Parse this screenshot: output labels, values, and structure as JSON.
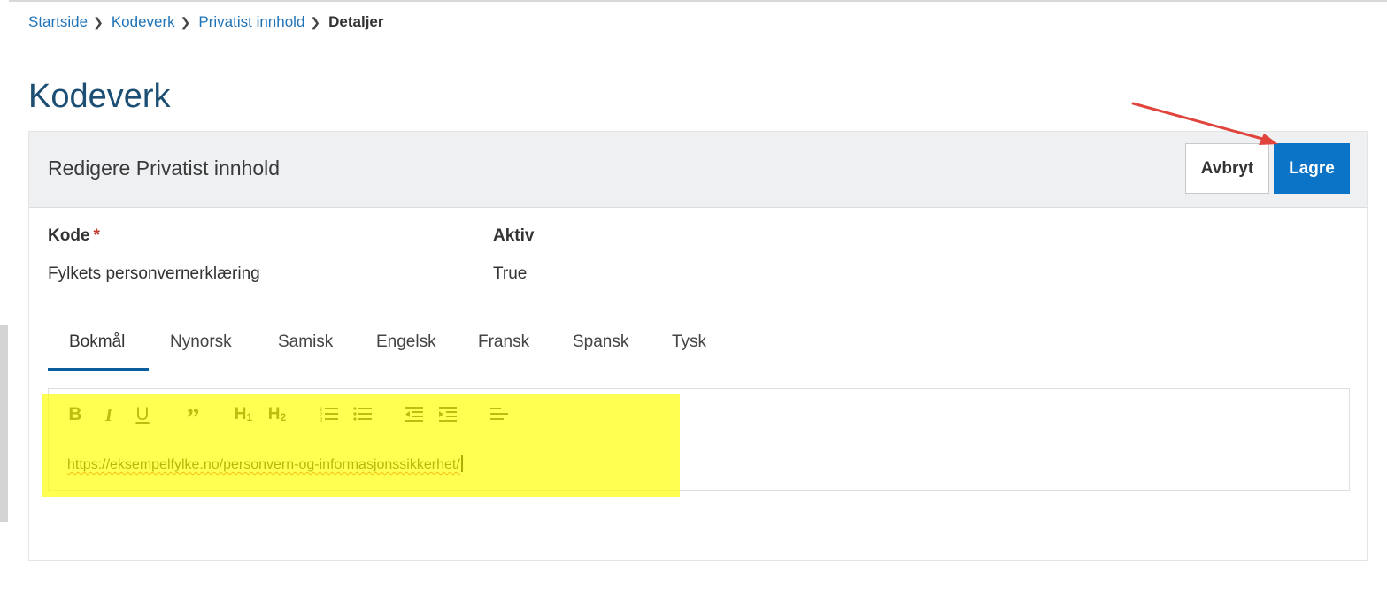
{
  "breadcrumb": {
    "items": [
      "Startside",
      "Kodeverk",
      "Privatist innhold"
    ],
    "current": "Detaljer"
  },
  "page": {
    "title": "Kodeverk"
  },
  "card": {
    "title": "Redigere Privatist innhold",
    "cancel_label": "Avbryt",
    "save_label": "Lagre"
  },
  "fields": {
    "kode_label": "Kode",
    "required_marker": "*",
    "kode_value": "Fylkets personvernerklæring",
    "aktiv_label": "Aktiv",
    "aktiv_value": "True"
  },
  "tabs": [
    "Bokmål",
    "Nynorsk",
    "Samisk",
    "Engelsk",
    "Fransk",
    "Spansk",
    "Tysk"
  ],
  "active_tab": "Bokmål",
  "editor": {
    "toolbar": [
      "bold-icon",
      "italic-icon",
      "underline-icon",
      "quote-icon",
      "heading1-icon",
      "heading2-icon",
      "ordered-list-icon",
      "bullet-list-icon",
      "outdent-icon",
      "indent-icon",
      "align-left-icon"
    ],
    "content": "https://eksempelfylke.no/personvern-og-informasjonssikkerhet/"
  },
  "colors": {
    "link": "#1f73b7",
    "title": "#1d4f74",
    "primary_button": "#0b74c6",
    "highlight": "#ffff00",
    "annotation_arrow": "#e0443c",
    "required": "#c0392b"
  }
}
